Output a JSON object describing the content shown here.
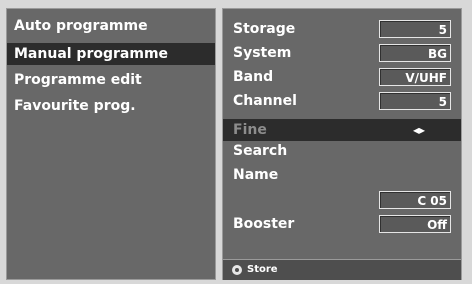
{
  "left_menu": {
    "items": [
      {
        "label": "Auto programme",
        "selected": false
      },
      {
        "label": "Manual programme",
        "selected": true
      },
      {
        "label": "Programme edit",
        "selected": false
      },
      {
        "label": "Favourite prog.",
        "selected": false
      }
    ]
  },
  "settings": {
    "storage": {
      "label": "Storage",
      "value": "5"
    },
    "system": {
      "label": "System",
      "value": "BG"
    },
    "band": {
      "label": "Band",
      "value": "V/UHF"
    },
    "channel": {
      "label": "Channel",
      "value": "5"
    },
    "fine": {
      "label": "Fine",
      "value": "◂▸"
    },
    "search": {
      "label": "Search"
    },
    "name": {
      "label": "Name",
      "value": "C 05"
    },
    "booster": {
      "label": "Booster",
      "value": "Off"
    }
  },
  "footer": {
    "icon": "ok-button-icon",
    "label": "Store"
  }
}
